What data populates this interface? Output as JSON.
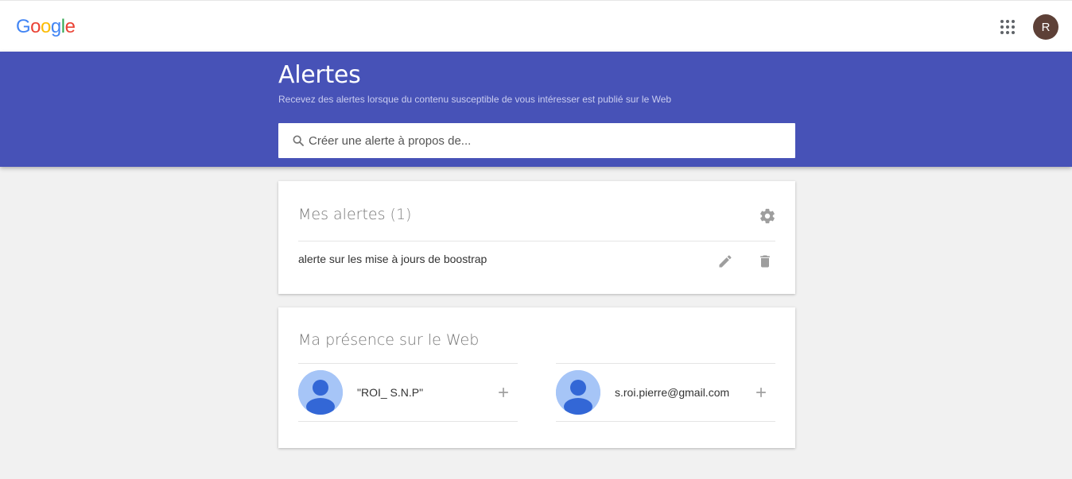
{
  "header": {
    "logo": [
      "G",
      "o",
      "o",
      "g",
      "l",
      "e"
    ],
    "logo_colors": [
      "#4285F4",
      "#EA4335",
      "#FBBC05",
      "#4285F4",
      "#34A853",
      "#EA4335"
    ],
    "apps_icon": "apps-grid-icon",
    "avatar_letter": "R",
    "avatar_color": "#5d4037"
  },
  "hero": {
    "title": "Alertes",
    "subtitle": "Recevez des alertes lorsque du contenu susceptible de vous intéresser est publié sur le Web",
    "background": "#4752b7",
    "search": {
      "placeholder": "Créer une alerte à propos de...",
      "icon": "search-icon"
    }
  },
  "alerts": {
    "title": "Mes alertes",
    "count": "(1)",
    "settings_icon": "gear-icon",
    "items": [
      {
        "label": "alerte sur les mise à jours de boostrap",
        "edit_icon": "pencil-icon",
        "delete_icon": "trash-icon"
      }
    ]
  },
  "presence": {
    "title": "Ma présence sur le Web",
    "people": [
      {
        "name": "\"ROI_ S.N.P\"",
        "icon": "plus-icon"
      },
      {
        "name": "s.roi.pierre@gmail.com",
        "icon": "plus-icon"
      }
    ]
  }
}
